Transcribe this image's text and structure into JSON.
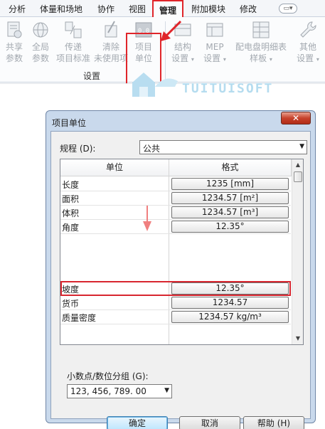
{
  "ribbon": {
    "tabs": [
      "分析",
      "体量和场地",
      "协作",
      "视图",
      "管理",
      "附加模块",
      "修改"
    ],
    "active_tab": "管理",
    "tools": [
      {
        "line1": "共享",
        "line2": "参数",
        "icon": "share-params-icon"
      },
      {
        "line1": "全局",
        "line2": "参数",
        "icon": "global-params-icon"
      },
      {
        "line1": "传递",
        "line2": "项目标准",
        "icon": "transfer-standards-icon"
      },
      {
        "line1": "清除",
        "line2": "未使用项",
        "icon": "purge-unused-icon"
      },
      {
        "line1": "项目",
        "line2": "单位",
        "icon": "project-units-icon",
        "icon_text": "0.0"
      },
      {
        "line1": "结构",
        "line2": "设置",
        "icon": "structural-settings-icon"
      },
      {
        "line1": "MEP",
        "line2": "设置",
        "icon": "mep-settings-icon"
      },
      {
        "line1": "配电盘明细表",
        "line2": "样板",
        "icon": "panel-schedule-icon"
      },
      {
        "line1": "其他",
        "line2": "设置",
        "icon": "wrench-icon"
      }
    ],
    "group_label": "设置"
  },
  "watermark": "TUITUISOFT",
  "dialog": {
    "title": "项目单位",
    "close": "✕",
    "discipline_label": "规程 (D):",
    "discipline_value": "公共",
    "columns": [
      "单位",
      "格式"
    ],
    "rows": [
      {
        "unit": "长度",
        "format": "1235 [mm]"
      },
      {
        "unit": "面积",
        "format": "1234.57 [m²]"
      },
      {
        "unit": "体积",
        "format": "1234.57 [m³]"
      },
      {
        "unit": "角度",
        "format": "12.35°"
      },
      {
        "unit": "坡度",
        "format": "12.35°"
      },
      {
        "unit": "货币",
        "format": "1234.57"
      },
      {
        "unit": "质量密度",
        "format": "1234.57 kg/m³"
      }
    ],
    "decimal_label": "小数点/数位分组 (G):",
    "decimal_value": "123, 456, 789. 00",
    "buttons": {
      "ok": "确定",
      "cancel": "取消",
      "help": "帮助 (H)"
    }
  },
  "colors": {
    "highlight": "#e0252a",
    "arrow": "#f07f7f"
  }
}
